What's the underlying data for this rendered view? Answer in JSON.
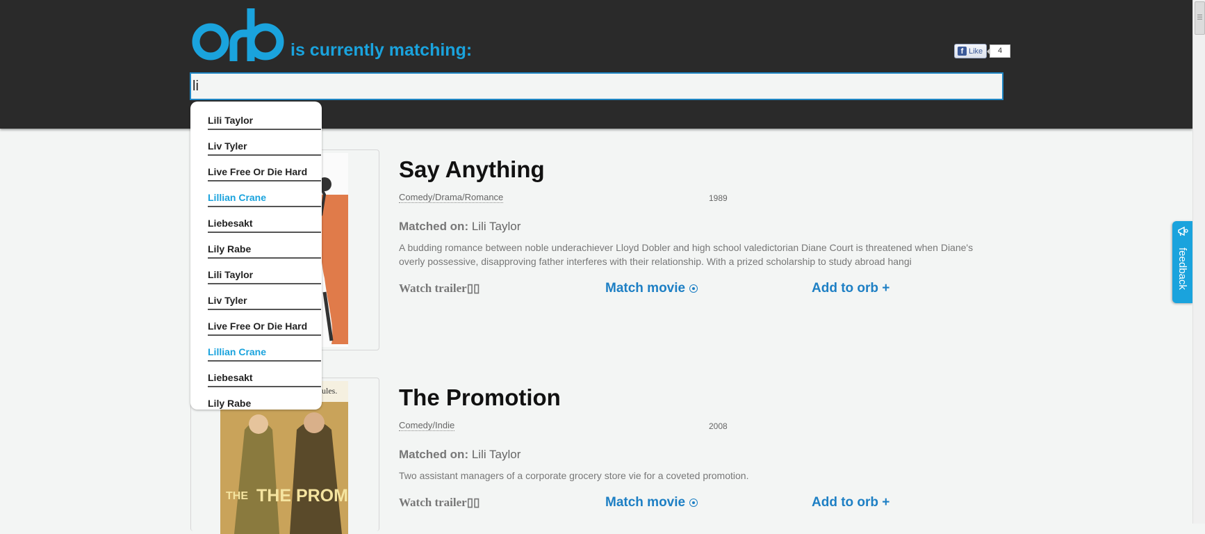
{
  "header": {
    "logo_text": "orb",
    "tagline": "is currently matching:",
    "fb_like_label": "Like",
    "fb_like_count": "4"
  },
  "search": {
    "value": "li"
  },
  "suggestions": [
    {
      "label": "Lili Taylor",
      "highlighted": false
    },
    {
      "label": "Liv Tyler",
      "highlighted": false
    },
    {
      "label": "Live Free Or Die Hard",
      "highlighted": false
    },
    {
      "label": "Lillian Crane",
      "highlighted": true
    },
    {
      "label": "Liebesakt",
      "highlighted": false
    },
    {
      "label": "Lily Rabe",
      "highlighted": false
    },
    {
      "label": "Lili Taylor",
      "highlighted": false
    },
    {
      "label": "Liv Tyler",
      "highlighted": false
    },
    {
      "label": "Live Free Or Die Hard",
      "highlighted": false
    },
    {
      "label": "Lillian Crane",
      "highlighted": true
    },
    {
      "label": "Liebesakt",
      "highlighted": false
    },
    {
      "label": "Lily Rabe",
      "highlighted": false
    }
  ],
  "movies": [
    {
      "title": "Say Anything",
      "genre": "Comedy/Drama/Romance",
      "year": "1989",
      "matched_label": "Matched on:",
      "matched_value": "Lili Taylor",
      "synopsis": "A budding romance between noble underachiever Lloyd Dobler and high school valedictorian Diane Court is threatened when Diane's overly possessive, disapproving father interferes with their relationship. With a prized scholarship to study abroad hangi",
      "watch_label": "Watch trailer",
      "match_label": "Match movie",
      "add_label": "Add to orb +"
    },
    {
      "title": "The Promotion",
      "genre": "Comedy/Indie",
      "year": "2008",
      "matched_label": "Matched on:",
      "matched_value": "Lili Taylor",
      "synopsis": "Two assistant managers of a corporate grocery store vie for a coveted promotion.",
      "watch_label": "Watch trailer",
      "match_label": "Match movie",
      "add_label": "Add to orb +",
      "poster_tagline": "ules.",
      "poster_title": "THE PROMOTION"
    }
  ],
  "feedback_label": "feedback",
  "colors": {
    "header_bg": "#2a2a2a",
    "accent": "#1aa3dd",
    "link": "#1d7fc4"
  }
}
